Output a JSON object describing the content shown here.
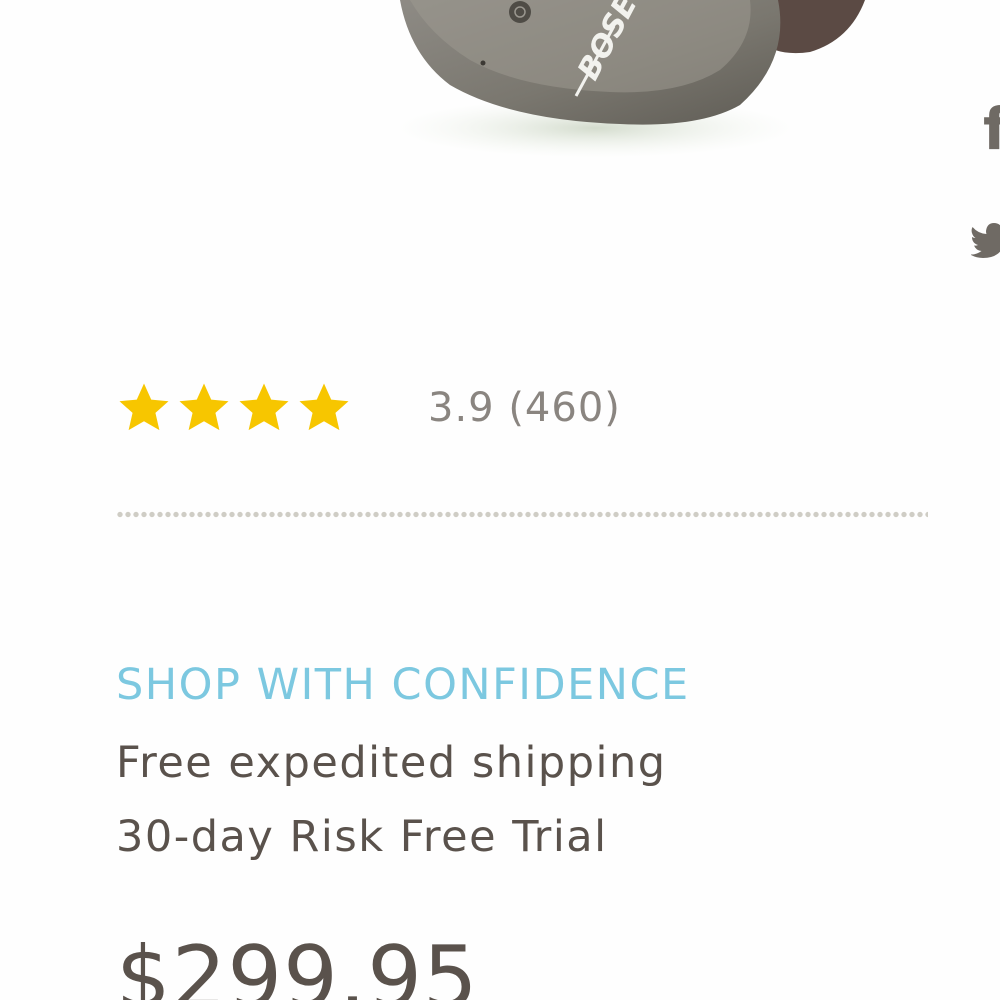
{
  "product": {
    "image_label": "BOSE",
    "price": "$299.95"
  },
  "social": {
    "icons": [
      "facebook-icon",
      "twitter-icon"
    ],
    "facebook_glyph": "f"
  },
  "rating": {
    "stars_filled": 4,
    "stars_total": 4,
    "text": "3.9 (460)",
    "star_color": "#f7c600"
  },
  "shop_with_confidence": {
    "title": "SHOP WITH CONFIDENCE",
    "benefits": [
      "Free expedited shipping",
      "30-day Risk Free Trial"
    ]
  },
  "colors": {
    "accent": "#7cc8e0",
    "text": "#5a524c",
    "muted": "#8a8580"
  }
}
